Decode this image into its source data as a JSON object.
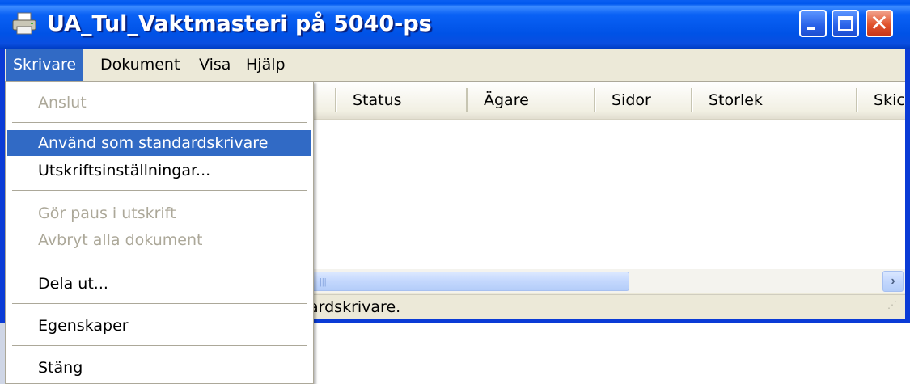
{
  "window": {
    "title": "UA_Tul_Vaktmasteri på 5040-ps",
    "icon": "printer-icon",
    "controls": {
      "minimize": "minimize-icon",
      "maximize": "maximize-icon",
      "close": "close-icon",
      "close_glyph": "✕"
    }
  },
  "menubar": {
    "items": [
      {
        "label": "Skrivare",
        "active": true
      },
      {
        "label": "Dokument"
      },
      {
        "label": "Visa"
      },
      {
        "label": "Hjälp"
      }
    ]
  },
  "listview": {
    "columns": [
      "Status",
      "Ägare",
      "Sidor",
      "Storlek",
      "Skick"
    ]
  },
  "scrollbar": {
    "right_arrow": "›"
  },
  "statusbar": {
    "text": "ardskrivare."
  },
  "dropdown": {
    "items": [
      {
        "label": "Anslut",
        "disabled": true
      },
      {
        "label": "Använd som standardskrivare",
        "highlighted": true
      },
      {
        "label": "Utskriftsinställningar..."
      },
      {
        "label": "Gör paus i utskrift",
        "disabled": true
      },
      {
        "label": "Avbryt alla dokument",
        "disabled": true
      },
      {
        "label": "Dela ut..."
      },
      {
        "label": "Egenskaper"
      },
      {
        "label": "Stäng"
      }
    ]
  },
  "colors": {
    "titlebar": "#0058ee",
    "menu_highlight": "#316ac5",
    "chrome": "#ece9d8",
    "disabled_text": "#aca899"
  }
}
